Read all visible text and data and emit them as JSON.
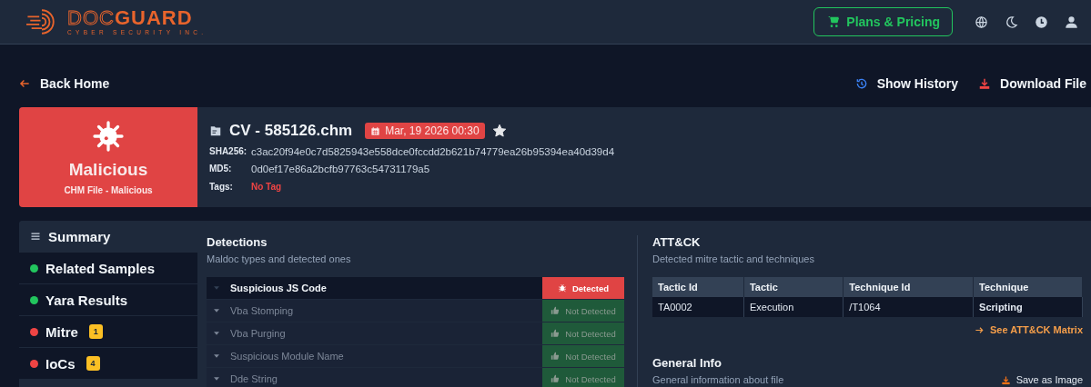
{
  "header": {
    "brand": "DOC**GUARD**",
    "tagline": "CYBER SECURITY INC.",
    "pricing_button": "Plans & Pricing"
  },
  "back_link": "Back Home",
  "actions": [
    {
      "kind": "history",
      "label": "Show History"
    },
    {
      "kind": "download",
      "label": "Download File"
    }
  ],
  "file": {
    "verdict": "Malicious",
    "verdict_sub": "CHM File - Malicious",
    "name": "CV - 585126.chm",
    "date": "Mar, 19 2026 00:30",
    "starred": true,
    "fields": [
      {
        "label": "SHA256:",
        "value": "c3ac20f94e0c7d5825943e558dce0fccdd2b621b74779ea26b95394ea40d39d4",
        "kind": "plain"
      },
      {
        "label": "MD5:",
        "value": "0d0ef17e86a2bcfb97763c54731179a5",
        "kind": "plain"
      },
      {
        "label": "Tags:",
        "value": "No Tag",
        "kind": "alert"
      }
    ]
  },
  "sidebar": {
    "items": [
      {
        "kind": "menu",
        "label": "Summary",
        "selected": true
      },
      {
        "kind": "dot",
        "label": "Related Samples",
        "selected": false,
        "color": "#22c55e"
      },
      {
        "kind": "dot",
        "label": "Yara Results",
        "selected": false,
        "color": "#22c55e"
      },
      {
        "kind": "dot",
        "label": "Mitre",
        "selected": false,
        "color": "#ef4444",
        "badge": "1"
      },
      {
        "kind": "dot",
        "label": "IoCs",
        "selected": false,
        "color": "#ef4444",
        "badge": "4"
      }
    ]
  },
  "detections": {
    "title": "Detections",
    "subtitle": "Maldoc types and detected ones",
    "rows": [
      {
        "name": "Suspicious JS Code",
        "detected": true,
        "status": "Detected"
      },
      {
        "name": "Vba Stomping",
        "detected": false,
        "status": "Not Detected"
      },
      {
        "name": "Vba Purging",
        "detected": false,
        "status": "Not Detected"
      },
      {
        "name": "Suspicious Module Name",
        "detected": false,
        "status": "Not Detected"
      },
      {
        "name": "Dde String",
        "detected": false,
        "status": "Not Detected"
      }
    ]
  },
  "attack": {
    "title": "ATT&CK",
    "subtitle": "Detected mitre tactic and techniques",
    "table": {
      "columns": [
        "Tactic Id",
        "Tactic",
        "Technique Id",
        "Technique"
      ],
      "rows": [
        [
          "TA0002",
          "Execution",
          "/T1064",
          "Scripting"
        ]
      ]
    },
    "matrix_link": "See ATT&CK Matrix"
  },
  "general_info": {
    "title": "General Info",
    "subtitle": "General information about file",
    "save_button": "Save as Image"
  }
}
